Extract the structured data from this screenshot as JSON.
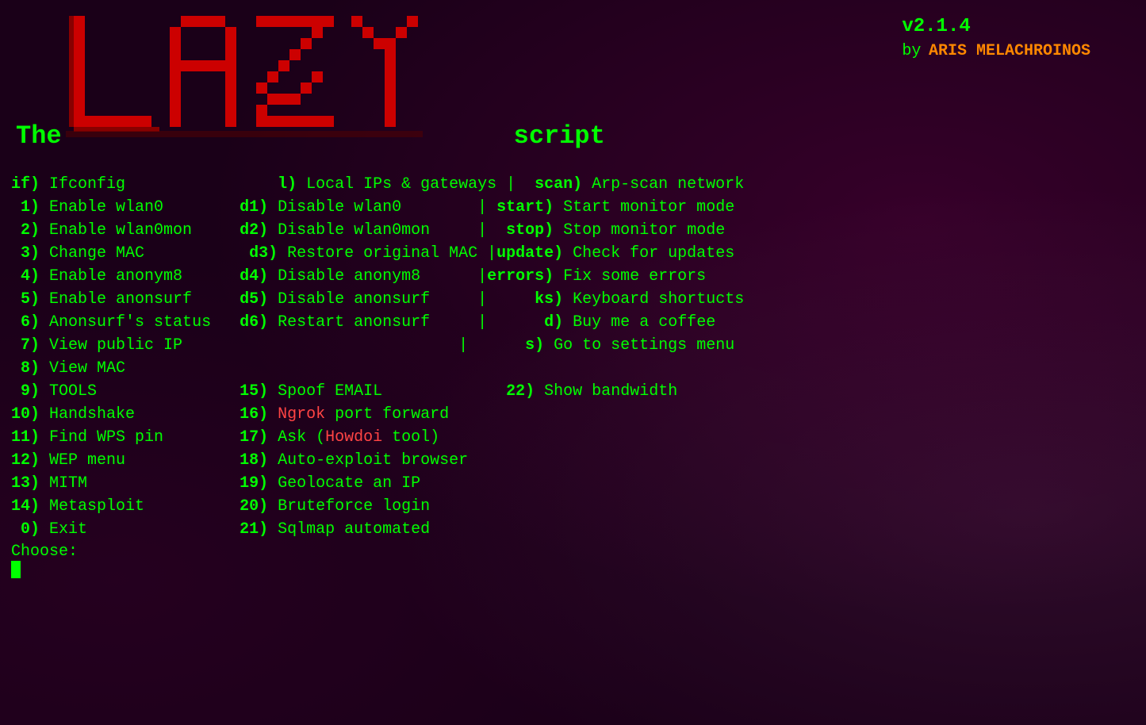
{
  "app": {
    "title": "LAZY Script",
    "version": "v2.1.4",
    "by_label": "by",
    "author": "ARIS MELACHROINOS",
    "the": "The",
    "script": "script"
  },
  "menu": {
    "col1": [
      {
        "key": "if)",
        "label": "Ifconfig"
      },
      {
        "key": " 1)",
        "label": "Enable wlan0"
      },
      {
        "key": " 2)",
        "label": "Enable wlan0mon"
      },
      {
        "key": " 3)",
        "label": "Change MAC"
      },
      {
        "key": " 4)",
        "label": "Enable anonym8"
      },
      {
        "key": " 5)",
        "label": "Enable anonsurf"
      },
      {
        "key": " 6)",
        "label": "Anonsurf's status"
      },
      {
        "key": " 7)",
        "label": "View public IP"
      },
      {
        "key": " 8)",
        "label": "View MAC"
      },
      {
        "key": " 9)",
        "label": "TOOLS"
      },
      {
        "key": "10)",
        "label": "Handshake"
      },
      {
        "key": "11)",
        "label": "Find WPS pin"
      },
      {
        "key": "12)",
        "label": "WEP menu"
      },
      {
        "key": "13)",
        "label": "MITM"
      },
      {
        "key": "14)",
        "label": "Metasploit"
      },
      {
        "key": " 0)",
        "label": "Exit"
      }
    ],
    "col2": [
      {
        "key": " l)",
        "label": "Local IPs & gateways"
      },
      {
        "key": "d1)",
        "label": "Disable wlan0"
      },
      {
        "key": "d2)",
        "label": "Disable wlan0mon"
      },
      {
        "key": "d3)",
        "label": "Restore original MAC"
      },
      {
        "key": "d4)",
        "label": "Disable anonym8"
      },
      {
        "key": "d5)",
        "label": "Disable anonsurf"
      },
      {
        "key": "d6)",
        "label": "Restart anonsurf"
      },
      {
        "key": "15)",
        "label": "Spoof EMAIL"
      },
      {
        "key": "16)",
        "label_prefix": "",
        "label": "port forward",
        "highlight": "Ngrok"
      },
      {
        "key": "17)",
        "label_prefix": "Ask (",
        "label": " tool)",
        "highlight": "Howdoi"
      },
      {
        "key": "18)",
        "label": "Auto-exploit browser"
      },
      {
        "key": "19)",
        "label": "Geolocate an IP"
      },
      {
        "key": "20)",
        "label": "Bruteforce login"
      },
      {
        "key": "21)",
        "label": "Sqlmap automated"
      }
    ],
    "col3": [
      {
        "key": " scan)",
        "label": "Arp-scan network"
      },
      {
        "key": "start)",
        "label": "Start monitor mode"
      },
      {
        "key": " stop)",
        "label": "Stop monitor mode"
      },
      {
        "key": "update)",
        "label": "Check for updates"
      },
      {
        "key": "errors)",
        "label": "Fix some errors"
      },
      {
        "key": "   ks)",
        "label": "Keyboard shortucts"
      },
      {
        "key": "    d)",
        "label": "Buy me a coffee"
      },
      {
        "key": "    s)",
        "label": "Go to settings menu"
      },
      {
        "key": "22)",
        "label": "Show bandwidth"
      }
    ]
  },
  "choose": {
    "label": "Choose:"
  }
}
